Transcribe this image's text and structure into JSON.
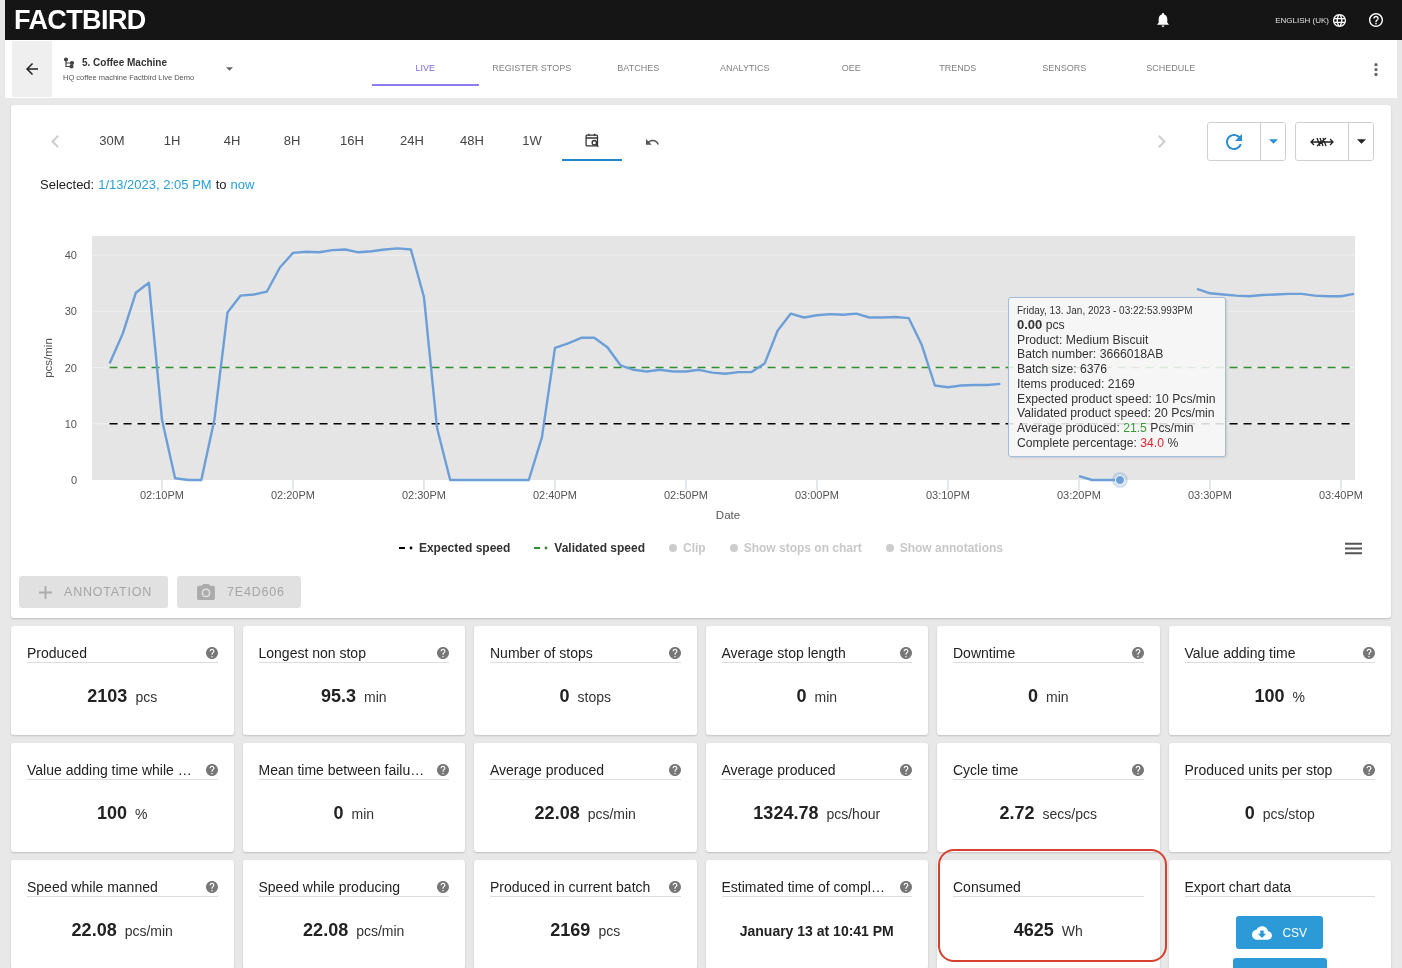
{
  "top_bar": {
    "logo": "FACTBIRD",
    "language": "ENGLISH (UK)"
  },
  "nav": {
    "machine": {
      "name": "5. Coffee Machine",
      "description": "HQ coffee machine Factbird Live Demo"
    },
    "tabs": [
      {
        "label": "LIVE",
        "selected": true
      },
      {
        "label": "REGISTER STOPS",
        "selected": false
      },
      {
        "label": "BATCHES",
        "selected": false
      },
      {
        "label": "ANALYTICS",
        "selected": false
      },
      {
        "label": "OEE",
        "selected": false
      },
      {
        "label": "TRENDS",
        "selected": false
      },
      {
        "label": "SENSORS",
        "selected": false
      },
      {
        "label": "SCHEDULE",
        "selected": false
      }
    ]
  },
  "chart_panel": {
    "previous": {
      "disabled": true
    },
    "ranges": [
      {
        "kind": "text",
        "label": "30M",
        "selected": false
      },
      {
        "kind": "text",
        "label": "1H",
        "selected": false
      },
      {
        "kind": "text",
        "label": "4H",
        "selected": false
      },
      {
        "kind": "text",
        "label": "8H",
        "selected": false
      },
      {
        "kind": "text",
        "label": "16H",
        "selected": false
      },
      {
        "kind": "text",
        "label": "24H",
        "selected": false
      },
      {
        "kind": "text",
        "label": "48H",
        "selected": false
      },
      {
        "kind": "text",
        "label": "1W",
        "selected": false
      },
      {
        "kind": "calendar",
        "selected": true
      }
    ],
    "next": {
      "disabled": true
    },
    "selection": {
      "label": "Selected:",
      "from": "1/13/2023, 2:05 PM",
      "joiner": "to",
      "to": "now"
    },
    "chart_data": {
      "type": "line",
      "xlabel": "Date",
      "ylabel": "pcs/min",
      "categories": [
        null,
        null,
        null,
        null,
        "02:10PM",
        null,
        null,
        null,
        null,
        null,
        null,
        null,
        null,
        null,
        "02:20PM",
        null,
        null,
        null,
        null,
        null,
        null,
        null,
        null,
        null,
        "02:30PM",
        null,
        null,
        null,
        null,
        null,
        null,
        null,
        null,
        null,
        "02:40PM",
        null,
        null,
        null,
        null,
        null,
        null,
        null,
        null,
        null,
        "02:50PM",
        null,
        null,
        null,
        null,
        null,
        null,
        null,
        null,
        null,
        "03:00PM",
        null,
        null,
        null,
        null,
        null,
        null,
        null,
        null,
        null,
        "03:10PM",
        null,
        null,
        null,
        null,
        null,
        null,
        null,
        null,
        null,
        "03:20PM",
        null,
        null,
        null,
        null,
        null,
        null,
        null,
        null,
        null,
        "03:30PM",
        null,
        null,
        null,
        null,
        null,
        null,
        null,
        null,
        null,
        "03:40PM",
        null
      ],
      "ylim": [
        0,
        43.4
      ],
      "yticks": [
        0,
        10,
        20,
        30,
        40
      ],
      "grid": true,
      "series": [
        {
          "color": "#6c9fd8",
          "values": [
            20.7,
            26.0,
            33.3,
            35.1,
            10.7,
            0.3,
            0,
            0,
            10.7,
            29.8,
            32.8,
            33.0,
            33.5,
            37.8,
            40.4,
            40.6,
            40.5,
            40.9,
            41.0,
            40.5,
            40.7,
            41.0,
            41.2,
            41.0,
            32.5,
            9.2,
            0,
            0,
            0,
            0,
            0,
            0,
            0,
            7.6,
            23.5,
            24.3,
            25.3,
            25.3,
            23.6,
            20.4,
            19.6,
            19.3,
            19.6,
            19.3,
            19.3,
            19.6,
            19.1,
            18.9,
            19.2,
            19.2,
            20.7,
            26.6,
            29.6,
            28.9,
            29.3,
            29.5,
            29.4,
            29.6,
            28.9,
            28.9,
            29.0,
            28.8,
            24.0,
            16.8,
            16.5,
            16.8,
            16.9,
            16.9,
            17.1,
            null,
            null,
            null,
            null,
            null,
            0.7,
            0,
            0,
            0,
            null,
            null,
            null,
            null,
            null,
            34.0,
            33.2,
            33.0,
            32.8,
            32.7,
            32.9,
            33.0,
            33.1,
            33.1,
            32.8,
            32.7,
            32.7,
            33.1
          ]
        }
      ],
      "ref_lines": [
        {
          "axis": "y",
          "value": 10,
          "label": "Expected speed",
          "color": "#000000"
        },
        {
          "axis": "y",
          "value": 20,
          "label": "Validated speed",
          "color": "#2f8f2f"
        }
      ]
    },
    "tooltip": {
      "title": "Friday, 13. Jan, 2023 - 03:22:53.993PM",
      "lines": [
        {
          "kind": "text",
          "text": "**0.00** pcs"
        },
        {
          "kind": "text",
          "text": "Product: Medium Biscuit"
        },
        {
          "kind": "text",
          "text": "Batch number: 3666018AB"
        },
        {
          "kind": "text",
          "text": "Batch size: 6376"
        },
        {
          "kind": "text",
          "text": "Items produced: 2169"
        },
        {
          "kind": "text",
          "text": "Expected product speed: 10 Pcs/min"
        },
        {
          "kind": "text",
          "text": "Validated product speed: 20 Pcs/min"
        },
        {
          "kind": "value",
          "label": "Average produced:",
          "value": "21.5",
          "unit": "Pcs/min",
          "color": "#3a9b35"
        },
        {
          "kind": "value",
          "label": "Complete percentage:",
          "value": "34.0",
          "unit": "%",
          "color": "#d9262c"
        }
      ]
    },
    "legend_toggles": [
      {
        "label": "Clip",
        "visible": false
      },
      {
        "label": "Show stops on chart",
        "visible": false
      },
      {
        "label": "Show annotations",
        "visible": false
      }
    ],
    "actions": [
      {
        "kind": "annotation",
        "label": "ANNOTATION",
        "disabled": true
      },
      {
        "kind": "snapshot",
        "label": "7E4D606",
        "disabled": true
      }
    ]
  },
  "cards": [
    {
      "kind": "metric",
      "title": "Produced",
      "help": true,
      "highlighted": false,
      "value": "2103",
      "unit": "pcs"
    },
    {
      "kind": "metric",
      "title": "Longest non stop",
      "help": true,
      "highlighted": false,
      "value": "95.3",
      "unit": "min"
    },
    {
      "kind": "metric",
      "title": "Number of stops",
      "help": true,
      "highlighted": false,
      "value": "0",
      "unit": "stops"
    },
    {
      "kind": "metric",
      "title": "Average stop length",
      "help": true,
      "highlighted": false,
      "value": "0",
      "unit": "min"
    },
    {
      "kind": "metric",
      "title": "Downtime",
      "help": true,
      "highlighted": false,
      "value": "0",
      "unit": "min"
    },
    {
      "kind": "metric",
      "title": "Value adding time",
      "help": true,
      "highlighted": false,
      "value": "100",
      "unit": "%"
    },
    {
      "kind": "metric",
      "title": "Value adding time while …",
      "help": true,
      "highlighted": false,
      "value": "100",
      "unit": "%"
    },
    {
      "kind": "metric",
      "title": "Mean time between failu…",
      "help": true,
      "highlighted": false,
      "value": "0",
      "unit": "min"
    },
    {
      "kind": "metric",
      "title": "Average produced",
      "help": true,
      "highlighted": false,
      "value": "22.08",
      "unit": "pcs/min"
    },
    {
      "kind": "metric",
      "title": "Average produced",
      "help": true,
      "highlighted": false,
      "value": "1324.78",
      "unit": "pcs/hour"
    },
    {
      "kind": "metric",
      "title": "Cycle time",
      "help": true,
      "highlighted": false,
      "value": "2.72",
      "unit": "secs/pcs"
    },
    {
      "kind": "metric",
      "title": "Produced units per stop",
      "help": true,
      "highlighted": false,
      "value": "0",
      "unit": "pcs/stop"
    },
    {
      "kind": "metric",
      "title": "Speed while manned",
      "help": true,
      "highlighted": false,
      "value": "22.08",
      "unit": "pcs/min"
    },
    {
      "kind": "metric",
      "title": "Speed while producing",
      "help": true,
      "highlighted": false,
      "value": "22.08",
      "unit": "pcs/min"
    },
    {
      "kind": "metric",
      "title": "Produced in current batch",
      "help": true,
      "highlighted": false,
      "value": "2169",
      "unit": "pcs"
    },
    {
      "kind": "text",
      "title": "Estimated time of compl…",
      "help": true,
      "highlighted": false,
      "value": "January 13 at 10:41 PM"
    },
    {
      "kind": "metric",
      "title": "Consumed",
      "help": false,
      "highlighted": true,
      "value": "4625",
      "unit": "Wh"
    },
    {
      "kind": "export",
      "title": "Export chart data",
      "help": false,
      "highlighted": false,
      "buttons": [
        {
          "kind": "csv",
          "label": "CSV"
        },
        {
          "kind": "cut-off"
        }
      ]
    }
  ]
}
